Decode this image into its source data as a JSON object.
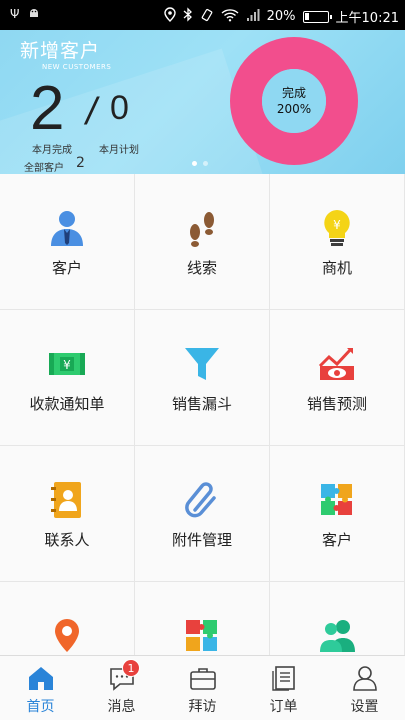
{
  "status_bar": {
    "battery_text": "20%",
    "battery_level": 0.2,
    "time": "上午10:21"
  },
  "banner": {
    "title": "新增客户",
    "subtitle": "NEW CUSTOMERS",
    "completed_value": "2",
    "slash": "/",
    "plan_value": "0",
    "completed_label": "本月完成",
    "plan_label": "本月计划",
    "all_customers_label": "全部客户",
    "all_customers_value": "2",
    "donut_label": "完成",
    "donut_percent": "200%",
    "donut_color": "#f24e8d",
    "page_count": 2,
    "active_page": 1
  },
  "grid": {
    "items": [
      {
        "label": "客户",
        "icon": "person-icon"
      },
      {
        "label": "线索",
        "icon": "footprints-icon"
      },
      {
        "label": "商机",
        "icon": "lightbulb-yen-icon"
      },
      {
        "label": "收款通知单",
        "icon": "banknote-icon"
      },
      {
        "label": "销售漏斗",
        "icon": "funnel-icon"
      },
      {
        "label": "销售预测",
        "icon": "chart-eye-icon"
      },
      {
        "label": "联系人",
        "icon": "contact-book-icon"
      },
      {
        "label": "附件管理",
        "icon": "paperclip-icon"
      },
      {
        "label": "客户",
        "icon": "puzzle-icon"
      },
      {
        "label": "",
        "icon": "map-pin-icon"
      },
      {
        "label": "",
        "icon": "puzzle-icon"
      },
      {
        "label": "",
        "icon": "users-icon"
      }
    ]
  },
  "tabbar": {
    "tabs": [
      {
        "label": "首页",
        "icon": "home-icon"
      },
      {
        "label": "消息",
        "icon": "chat-icon"
      },
      {
        "label": "拜访",
        "icon": "briefcase-icon"
      },
      {
        "label": "订单",
        "icon": "document-icon"
      },
      {
        "label": "设置",
        "icon": "user-settings-icon"
      }
    ],
    "message_badge": "1",
    "active_index": 0
  }
}
